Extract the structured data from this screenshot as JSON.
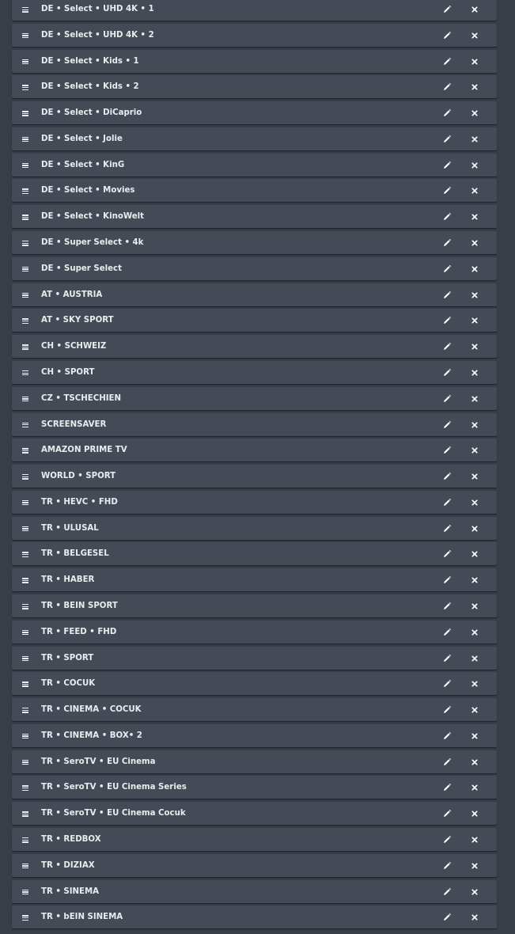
{
  "bouquets": [
    {
      "label": "DE • Select • UHD 4K • 1"
    },
    {
      "label": "DE • Select • UHD 4K • 2"
    },
    {
      "label": "DE • Select • Kids • 1"
    },
    {
      "label": "DE • Select • Kids • 2"
    },
    {
      "label": "DE • Select • DiCaprio"
    },
    {
      "label": "DE • Select • Jolie"
    },
    {
      "label": "DE • Select • KinG"
    },
    {
      "label": "DE • Select • Movies"
    },
    {
      "label": "DE • Select • KinoWelt"
    },
    {
      "label": "DE • Super Select • 4k"
    },
    {
      "label": "DE • Super Select"
    },
    {
      "label": "AT • AUSTRIA"
    },
    {
      "label": "AT • SKY SPORT"
    },
    {
      "label": "CH • SCHWEIZ"
    },
    {
      "label": "CH • SPORT"
    },
    {
      "label": "CZ • TSCHECHIEN"
    },
    {
      "label": "SCREENSAVER"
    },
    {
      "label": "AMAZON PRIME TV"
    },
    {
      "label": "WORLD • SPORT"
    },
    {
      "label": "TR • HEVC • FHD"
    },
    {
      "label": "TR • ULUSAL"
    },
    {
      "label": "TR • BELGESEL"
    },
    {
      "label": "TR • HABER"
    },
    {
      "label": "TR • BEIN SPORT"
    },
    {
      "label": "TR • FEED • FHD"
    },
    {
      "label": "TR • SPORT"
    },
    {
      "label": "TR • COCUK"
    },
    {
      "label": "TR • CINEMA • COCUK"
    },
    {
      "label": "TR • CINEMA • BOX• 2"
    },
    {
      "label": "TR • SeroTV • EU Cinema"
    },
    {
      "label": "TR • SeroTV • EU Cinema Series"
    },
    {
      "label": "TR • SeroTV • EU Cinema Cocuk"
    },
    {
      "label": "TR • REDBOX"
    },
    {
      "label": "TR • DIZIAX"
    },
    {
      "label": "TR • SINEMA"
    },
    {
      "label": "TR • bEIN SINEMA"
    }
  ],
  "icons": {
    "drag": "drag-handle-icon",
    "edit": "pencil-icon",
    "delete": "close-icon"
  },
  "colors": {
    "background": "#373e48",
    "row": "#444b56",
    "text": "#e9ecef"
  }
}
